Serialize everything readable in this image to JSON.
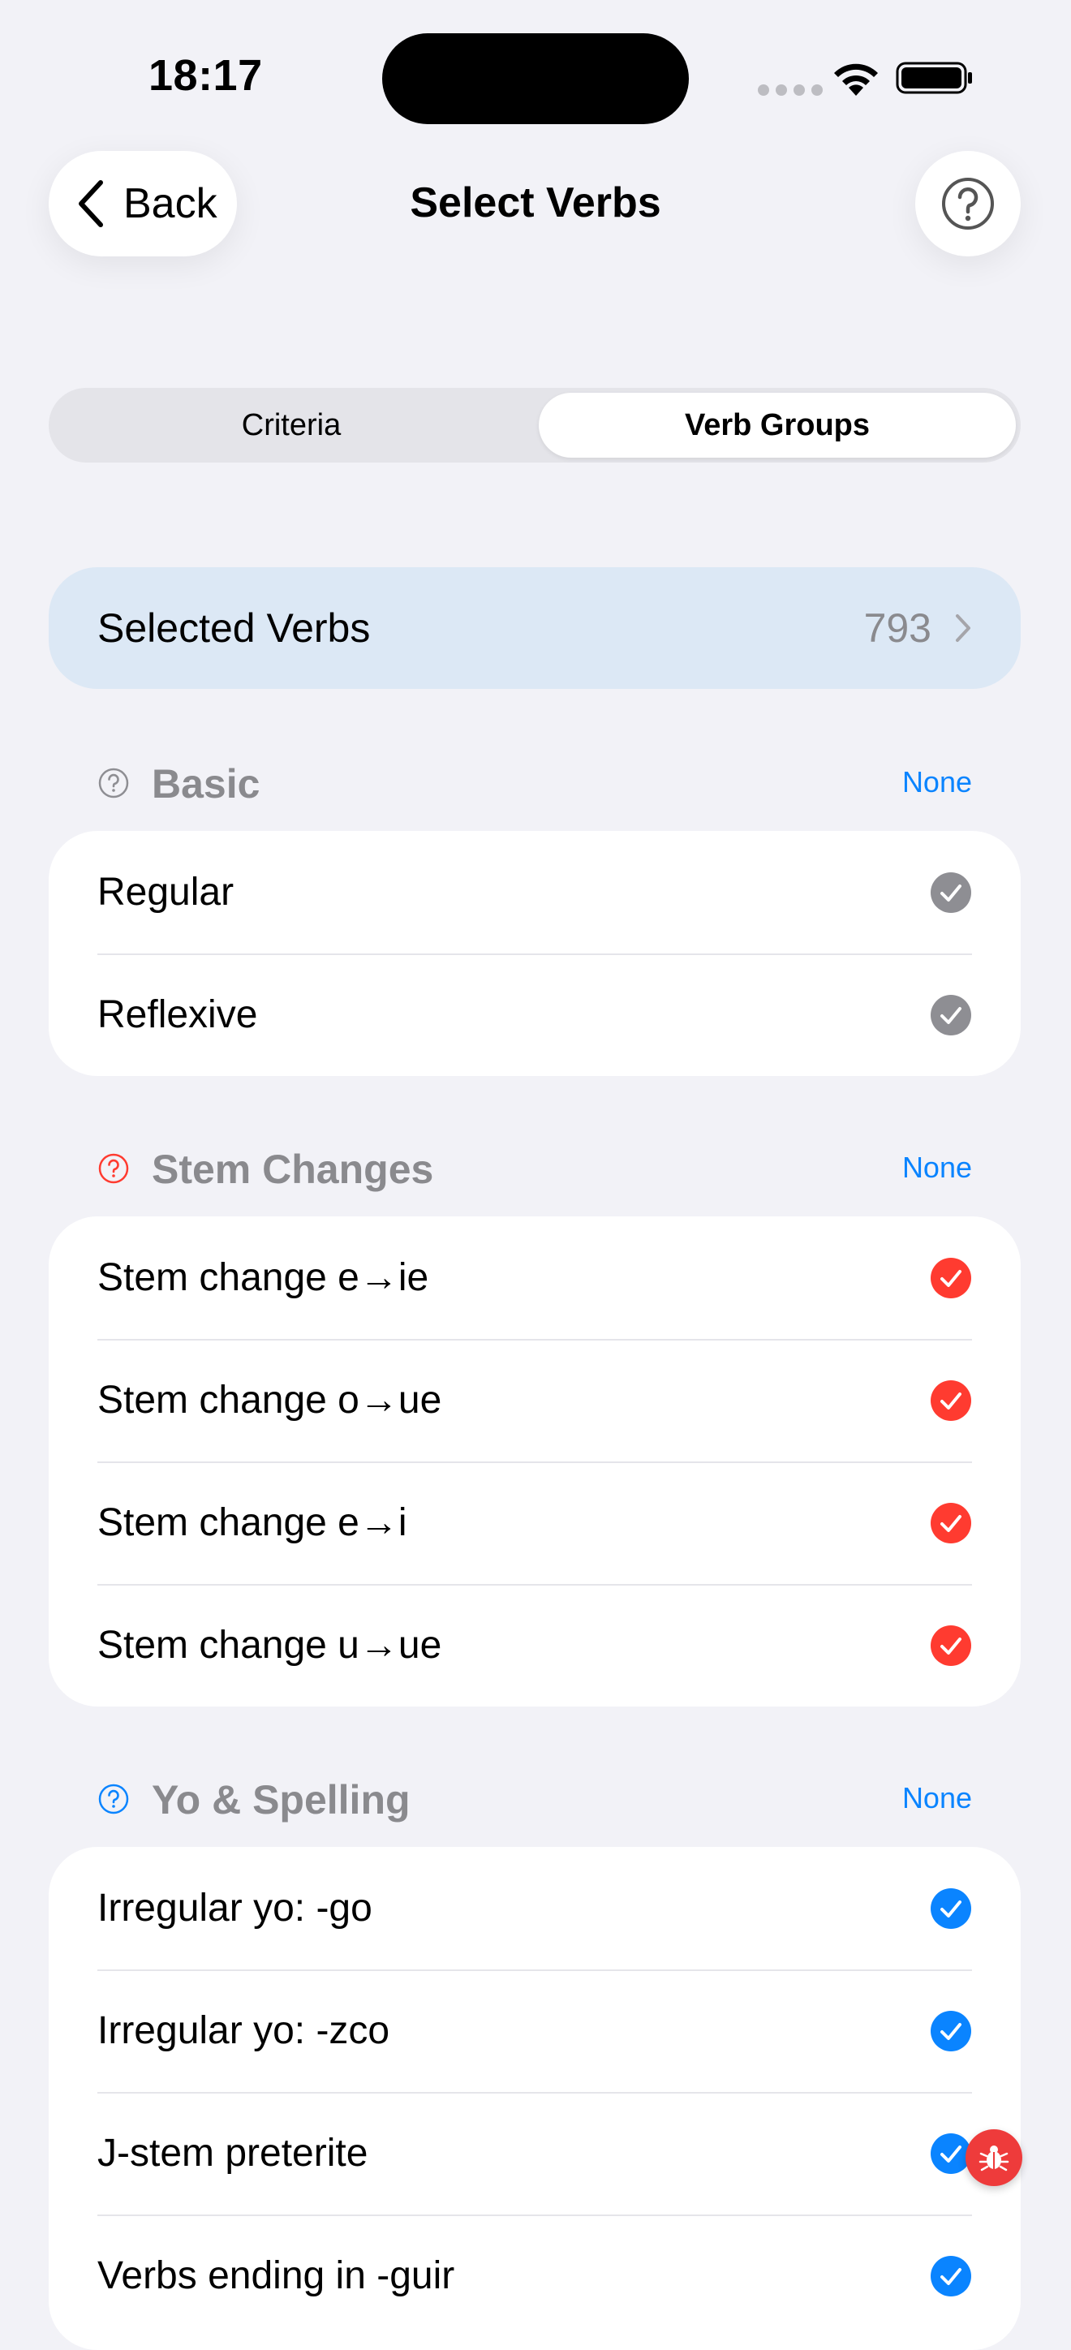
{
  "status_bar": {
    "time": "18:17"
  },
  "nav": {
    "back_label": "Back",
    "title": "Select Verbs",
    "help_icon": "question-circle-icon"
  },
  "segmented": {
    "tabs": [
      "Criteria",
      "Verb Groups"
    ],
    "selected": "Verb Groups"
  },
  "selected_verbs": {
    "label": "Selected Verbs",
    "count": "793"
  },
  "colors": {
    "accent": "#0A84FF",
    "basic": "#8E8E93",
    "stem": "#FF3B30",
    "spelling": "#0A84FF",
    "card_blue": "#DCE8F5"
  },
  "sections": [
    {
      "title": "Basic",
      "action": "None",
      "color": "#8E8E93",
      "items": [
        "Regular",
        "Reflexive"
      ]
    },
    {
      "title": "Stem Changes",
      "action": "None",
      "color": "#FF3B30",
      "items": [
        "Stem change e→ie",
        "Stem change o→ue",
        "Stem change e→i",
        "Stem change u→ue"
      ]
    },
    {
      "title": "Yo & Spelling",
      "action": "None",
      "color": "#0A84FF",
      "items": [
        "Irregular yo: -go",
        "Irregular yo: -zco",
        "J-stem preterite",
        "Verbs ending in -guir"
      ]
    }
  ]
}
